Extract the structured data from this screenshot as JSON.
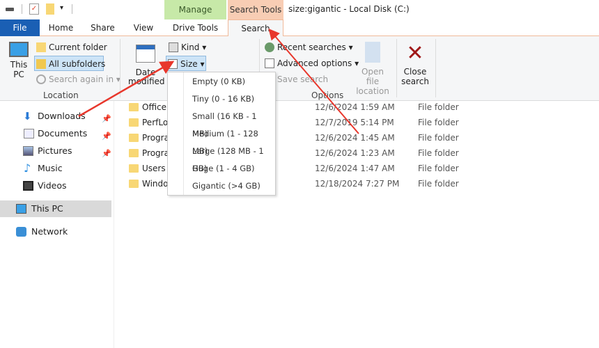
{
  "window": {
    "title": "size:gigantic - Local Disk (C:)"
  },
  "quick_access": {
    "icons": [
      "drive-icon",
      "properties-icon",
      "new-folder-icon",
      "customize-dropdown-icon"
    ]
  },
  "context_tabs": {
    "manage": "Manage",
    "search_tools": "Search Tools"
  },
  "tabs": [
    {
      "label": "File"
    },
    {
      "label": "Home"
    },
    {
      "label": "Share"
    },
    {
      "label": "View"
    },
    {
      "label": "Drive Tools"
    },
    {
      "label": "Search",
      "active": true
    }
  ],
  "ribbon": {
    "location": {
      "this_pc": "This PC",
      "current_folder": "Current folder",
      "all_subfolders": "All subfolders",
      "search_again": "Search again in",
      "group": "Location"
    },
    "refine": {
      "date_modified": "Date modified",
      "kind": "Kind",
      "size": "Size"
    },
    "options": {
      "recent": "Recent searches",
      "advanced": "Advanced options",
      "save": "Save search",
      "open_location": "Open file location",
      "group": "Options"
    },
    "close": "Close search"
  },
  "size_menu": [
    "Empty (0 KB)",
    "Tiny (0 - 16 KB)",
    "Small (16 KB - 1 MB)",
    "Medium (1 - 128 MB)",
    "Large (128 MB - 1 GB)",
    "Huge (1 - 4 GB)",
    "Gigantic (>4 GB)"
  ],
  "nav": [
    {
      "label": "Downloads",
      "pinned": true
    },
    {
      "label": "Documents",
      "pinned": true
    },
    {
      "label": "Pictures",
      "pinned": true
    },
    {
      "label": "Music"
    },
    {
      "label": "Videos"
    },
    {
      "label": "This PC",
      "selected": true
    },
    {
      "label": "Network"
    }
  ],
  "files": [
    {
      "name": "Office",
      "date": "12/6/2024 1:59 AM",
      "type": "File folder"
    },
    {
      "name": "PerfLo",
      "date": "12/7/2019 5:14 PM",
      "type": "File folder"
    },
    {
      "name": "Progra",
      "date": "12/6/2024 1:45 AM",
      "type": "File folder"
    },
    {
      "name": "Progra",
      "date": "12/6/2024 1:23 AM",
      "type": "File folder"
    },
    {
      "name": "Users",
      "date": "12/6/2024 1:47 AM",
      "type": "File folder"
    },
    {
      "name": "Windo",
      "date": "12/18/2024 7:27 PM",
      "type": "File folder"
    }
  ],
  "colors": {
    "file_tab": "#1a5fb4",
    "manage": "#c7e9a8",
    "search_tools": "#f8cdb4",
    "annotation_arrow": "#e8372c"
  }
}
